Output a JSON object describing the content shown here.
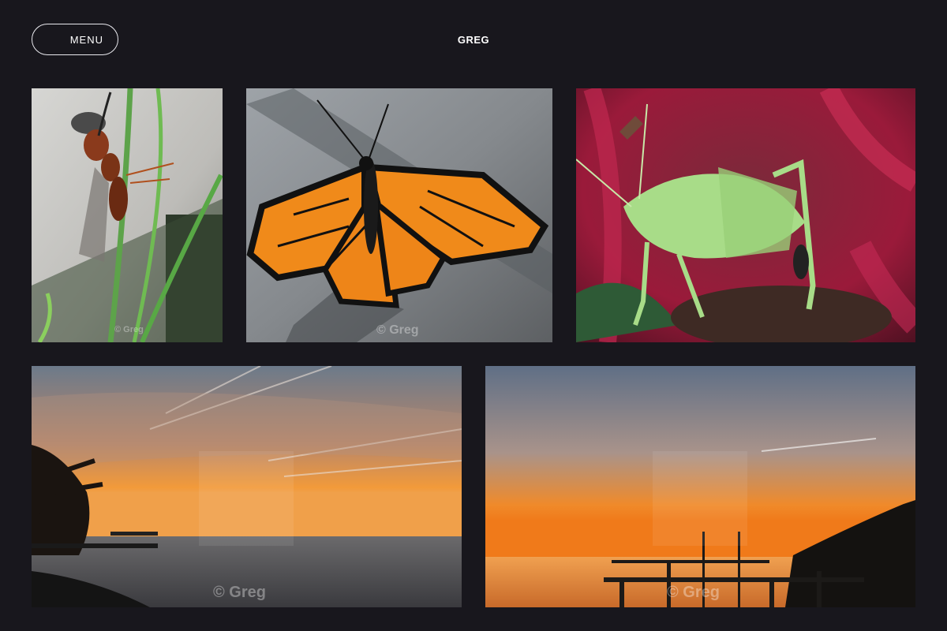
{
  "header": {
    "menu_label": "MENU",
    "site_title": "GREG"
  },
  "gallery": {
    "images": [
      {
        "subject": "wasp on grass blade",
        "watermark": "© Greg"
      },
      {
        "subject": "orange and black butterfly",
        "watermark": "© Greg"
      },
      {
        "subject": "green katydid on red plant",
        "watermark": ""
      },
      {
        "subject": "sunset over water with tree",
        "watermark": "© Greg"
      },
      {
        "subject": "sunset over water with pier",
        "watermark": "© Greg"
      }
    ]
  }
}
